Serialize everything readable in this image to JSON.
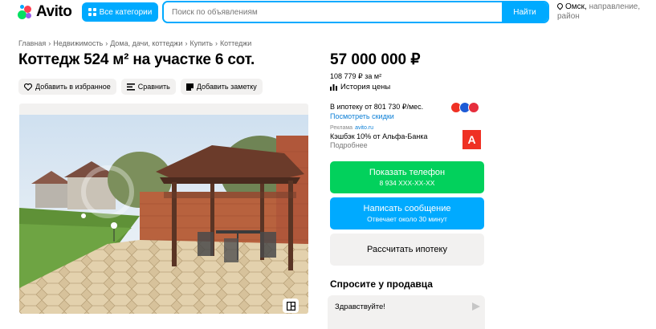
{
  "header": {
    "logo_text": "Avito",
    "categories_button": "Все категории",
    "search_placeholder": "Поиск по объявлениям",
    "search_button": "Найти",
    "location_city": "Омск,",
    "location_rest": " направление, район"
  },
  "breadcrumbs": [
    "Главная",
    "Недвижимость",
    "Дома, дачи, коттеджи",
    "Купить",
    "Коттеджи"
  ],
  "listing": {
    "title": "Коттедж 524 м² на участке 6 сот.",
    "actions": {
      "favorite": "Добавить в избранное",
      "compare": "Сравнить",
      "note": "Добавить заметку"
    },
    "price": "57 000 000 ₽",
    "price_per_m2": "108 779 ₽ за м²",
    "price_history": "История цены",
    "mortgage_line": "В ипотеку от 801 730 ₽/мес.",
    "mortgage_link": "Посмотреть скидки",
    "ad": {
      "label": "Реклама",
      "site": "avito.ru",
      "title": "Кэшбэк 10% от Альфа-Банка",
      "more": "Подробнее",
      "bank_logo_letter": "А"
    },
    "buttons": {
      "phone": "Показать телефон",
      "phone_number": "8 934 XXX-XX-XX",
      "message": "Написать сообщение",
      "message_sub": "Отвечает около 30 минут",
      "mortgage": "Рассчитать ипотеку"
    },
    "ask_seller": "Спросите у продавца",
    "message_text": "Здравствуйте!"
  },
  "colors": {
    "accent_blue": "#00aaff",
    "phone_green": "#02d15c",
    "alfa_red": "#ef3124"
  }
}
